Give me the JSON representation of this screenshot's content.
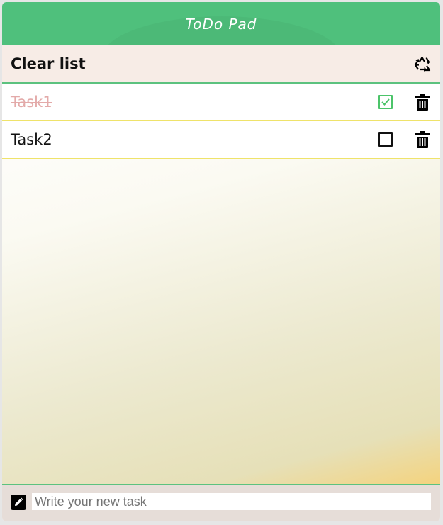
{
  "header": {
    "title": "ToDo Pad"
  },
  "toolbar": {
    "clear_label": "Clear list",
    "clear_icon": "recycle-icon"
  },
  "tasks": [
    {
      "text": "Task1",
      "done": true
    },
    {
      "text": "Task2",
      "done": false
    }
  ],
  "new_task": {
    "placeholder": "Write your new task",
    "value": ""
  },
  "colors": {
    "header": "#4fc07c",
    "accent_green": "#5cc27f",
    "check_done": "#4cc46a",
    "done_text": "#e3aaa9",
    "task_border": "#efe36a"
  }
}
